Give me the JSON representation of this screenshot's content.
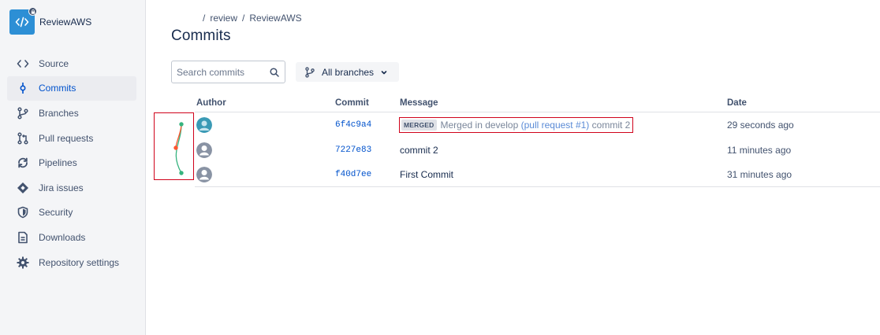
{
  "repo": {
    "name": "ReviewAWS"
  },
  "sidebar": {
    "items": [
      {
        "label": "Source",
        "icon": "code-icon",
        "active": false
      },
      {
        "label": "Commits",
        "icon": "commit-icon",
        "active": true
      },
      {
        "label": "Branches",
        "icon": "branch-icon",
        "active": false
      },
      {
        "label": "Pull requests",
        "icon": "pull-request-icon",
        "active": false
      },
      {
        "label": "Pipelines",
        "icon": "pipelines-icon",
        "active": false
      },
      {
        "label": "Jira issues",
        "icon": "jira-icon",
        "active": false
      },
      {
        "label": "Security",
        "icon": "shield-icon",
        "active": false
      },
      {
        "label": "Downloads",
        "icon": "document-icon",
        "active": false
      },
      {
        "label": "Repository settings",
        "icon": "gear-icon",
        "active": false
      }
    ]
  },
  "breadcrumb": {
    "sep1": "/",
    "project": "review",
    "sep2": "/",
    "repo": "ReviewAWS"
  },
  "page": {
    "title": "Commits"
  },
  "search": {
    "placeholder": "Search commits"
  },
  "branch_filter": {
    "label": "All branches"
  },
  "table": {
    "columns": {
      "author": "Author",
      "commit": "Commit",
      "message": "Message",
      "date": "Date"
    },
    "rows": [
      {
        "hash": "6f4c9a4",
        "badge": "MERGED",
        "msg_prefix": "Merged in develop ",
        "msg_link": "(pull request #1)",
        "msg_suffix": " commit 2",
        "date": "29 seconds ago",
        "avatar": "teal"
      },
      {
        "hash": "7227e83",
        "message": "commit 2",
        "date": "11 minutes ago",
        "avatar": "grey"
      },
      {
        "hash": "f40d7ee",
        "message": "First Commit",
        "date": "31 minutes ago",
        "avatar": "grey"
      }
    ]
  },
  "colors": {
    "accent": "#0052cc",
    "graph_green": "#36b37e",
    "graph_orange": "#ff5630",
    "highlight_red": "#d0021b"
  }
}
